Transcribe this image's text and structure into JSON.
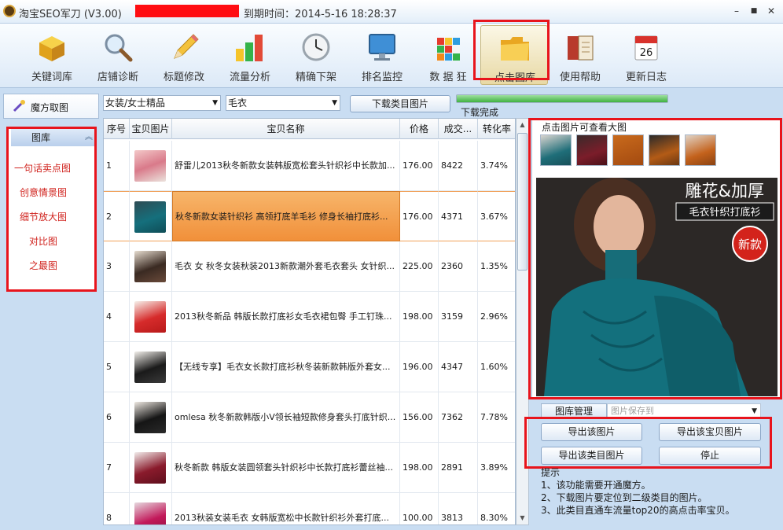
{
  "window": {
    "title": "淘宝SEO军刀 (V3.00)",
    "expire": "到期时间：2014-5-16 18:28:37",
    "minimize": "–",
    "maximize": "■",
    "close": "✕"
  },
  "toolbar": [
    {
      "label": "关键词库",
      "icon": "box-icon"
    },
    {
      "label": "店铺诊断",
      "icon": "magnifier-icon"
    },
    {
      "label": "标题修改",
      "icon": "pencil-icon"
    },
    {
      "label": "流量分析",
      "icon": "bar-chart-icon"
    },
    {
      "label": "精确下架",
      "icon": "clock-icon"
    },
    {
      "label": "排名监控",
      "icon": "monitor-icon"
    },
    {
      "label": "数 据 狂",
      "icon": "cube-icon"
    },
    {
      "label": "点击图库",
      "icon": "folder-icon",
      "active": true
    },
    {
      "label": "使用帮助",
      "icon": "book-icon"
    },
    {
      "label": "更新日志",
      "icon": "calendar-icon",
      "day": "26"
    }
  ],
  "left": {
    "tab": "魔方取图",
    "library_header": "图库",
    "items": [
      "一句话卖点图",
      "创意情景图",
      "细节放大图",
      "对比图",
      "之最图"
    ]
  },
  "filters": {
    "category": "女装/女士精品",
    "subcategory": "毛衣",
    "download_button": "下载类目图片",
    "progress": 1.0,
    "status": "下载完成"
  },
  "table": {
    "headers": [
      "序号",
      "宝贝图片",
      "宝贝名称",
      "价格",
      "成交...",
      "转化率"
    ],
    "selected_row": 1,
    "rows": [
      {
        "no": "1",
        "name": "舒雷儿2013秋冬新款女装韩版宽松套头针织衫中长款加...",
        "price": "176.00",
        "sold": "8422",
        "rate": "3.74%"
      },
      {
        "no": "2",
        "name": "秋冬新款女装针织衫 高领打底羊毛衫 修身长袖打底衫...",
        "price": "176.00",
        "sold": "4371",
        "rate": "3.67%"
      },
      {
        "no": "3",
        "name": "毛衣 女 秋冬女装秋装2013新款潮外套毛衣套头 女针织...",
        "price": "225.00",
        "sold": "2360",
        "rate": "1.35%"
      },
      {
        "no": "4",
        "name": "2013秋冬新品 韩版长款打底衫女毛衣裙包臀 手工钉珠...",
        "price": "198.00",
        "sold": "3159",
        "rate": "2.96%"
      },
      {
        "no": "5",
        "name": "【无线专享】毛衣女长款打底衫秋冬装新款韩版外套女...",
        "price": "196.00",
        "sold": "4347",
        "rate": "1.60%"
      },
      {
        "no": "6",
        "name": "omlesa 秋冬新款韩版小V领长袖短款修身套头打底针织...",
        "price": "156.00",
        "sold": "7362",
        "rate": "7.78%"
      },
      {
        "no": "7",
        "name": "秋冬新款 韩版女装圆领套头针织衫中长款打底衫蕾丝袖...",
        "price": "198.00",
        "sold": "2891",
        "rate": "3.89%"
      },
      {
        "no": "8",
        "name": "2013秋装女装毛衣 女韩版宽松中长款针织衫外套打底...",
        "price": "100.00",
        "sold": "3813",
        "rate": "8.30%"
      }
    ]
  },
  "preview": {
    "hint": "点击图片可查看大图",
    "banner_line1": "雕花&加厚",
    "banner_line2": "毛衣针织打底衫",
    "badge": "新款"
  },
  "manage": {
    "tab": "图库管理",
    "save_placeholder": "图片保存到"
  },
  "buttons": {
    "export_image": "导出该图片",
    "export_item": "导出该宝贝图片",
    "export_category": "导出该类目图片",
    "stop": "停止"
  },
  "tips": {
    "title": "提示",
    "lines": [
      "1、该功能需要开通魔方。",
      "2、下载图片要定位到二级类目的图片。",
      "3、此类目直通车流量top20的高点击率宝贝。"
    ]
  },
  "colors": {
    "highlight_red": "#e8141c",
    "selected_row": "#f1903a",
    "library_item": "#d0231e"
  }
}
